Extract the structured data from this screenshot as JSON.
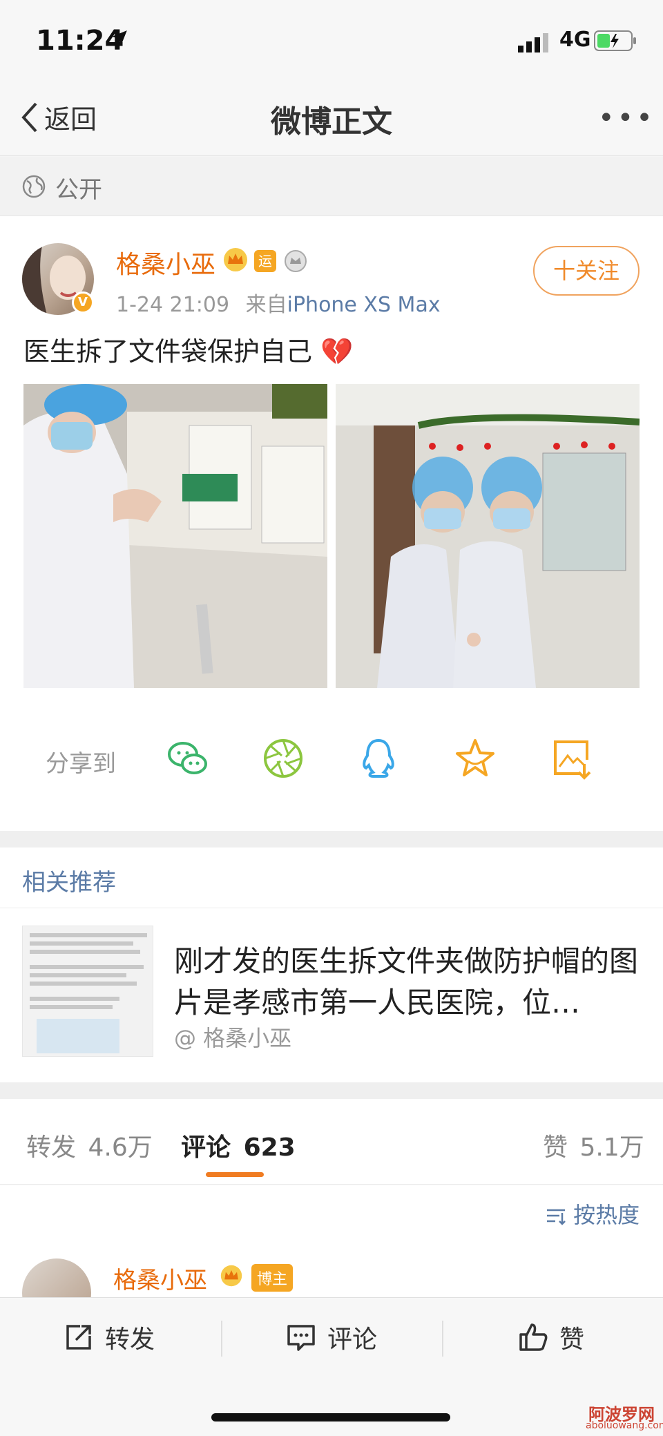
{
  "status_bar": {
    "time": "11:24",
    "network": "4G"
  },
  "nav": {
    "back_label": "返回",
    "title": "微博正文",
    "more": "•••"
  },
  "visibility": {
    "label": "公开"
  },
  "post": {
    "author": "格桑小巫",
    "badge_yun": "运",
    "date": "1-24 21:09",
    "source_prefix": "来自",
    "source": "iPhone XS Max",
    "follow_label": "十关注",
    "text": "医生拆了文件袋保护自己 💔"
  },
  "share": {
    "label": "分享到",
    "targets": [
      "wechat-icon",
      "moments-icon",
      "qq-icon",
      "favorite-icon",
      "save-image-icon"
    ]
  },
  "related": {
    "header": "相关推荐",
    "title": "刚才发的医生拆文件夹做防护帽的图片是孝感市第一人民医院，位…",
    "author": "@ 格桑小巫"
  },
  "tabs": [
    {
      "label": "转发",
      "count": "4.6万"
    },
    {
      "label": "评论",
      "count": "623"
    },
    {
      "label": "赞",
      "count": "5.1万"
    }
  ],
  "sort_label": "按热度",
  "comment": {
    "author": "格桑小巫",
    "host_badge": "博主"
  },
  "bottom_bar": {
    "repost": "转发",
    "comment": "评论",
    "like": "赞"
  },
  "watermark": {
    "text": "阿波罗网",
    "url": "aboluowang.com"
  },
  "colors": {
    "accent_orange": "#f07c22",
    "link_blue": "#5b7ba6",
    "name_orange": "#e86b0c"
  }
}
